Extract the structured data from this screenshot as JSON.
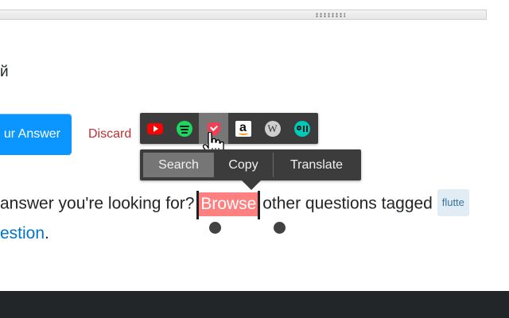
{
  "browser": {
    "resize_grip_icon": "drag-grip-icon"
  },
  "page": {
    "cyrillic_fragment": "й",
    "post_button_label": "ur Answer",
    "discard_label": "Discard",
    "question_prefix": "answer you're looking for?",
    "selected_word": "Browse",
    "question_suffix": "other questions tagged",
    "tag_label": "flutte",
    "link_text": "estion",
    "link_trailing": "."
  },
  "icon_toolbar": {
    "items": [
      {
        "icon": "youtube-icon"
      },
      {
        "icon": "spotify-icon"
      },
      {
        "icon": "pocket-icon",
        "active": true
      },
      {
        "icon": "amazon-icon",
        "glyph": "a"
      },
      {
        "icon": "wikipedia-icon",
        "glyph": "W"
      },
      {
        "icon": "medium-icon"
      }
    ]
  },
  "context_menu": {
    "search_label": "Search",
    "copy_label": "Copy",
    "translate_label": "Translate"
  },
  "colors": {
    "post_button": "#0a95ff",
    "discard_text": "#c22e32",
    "selection_highlight": "#ff8080",
    "toolbar_bg": "#3c3c3c",
    "footer_bg": "#232629",
    "link": "#0074cc"
  }
}
